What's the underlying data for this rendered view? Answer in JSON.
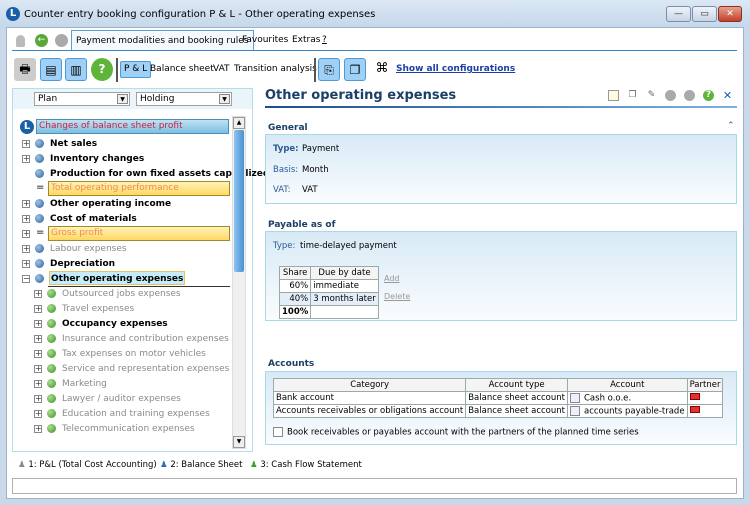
{
  "window": {
    "title": "Counter entry booking configuration  P & L - Other operating expenses",
    "minimize": "—",
    "maximize": "▭",
    "close": "✕"
  },
  "menu": {
    "tabs": [
      {
        "label": "Payment modalities and booking rules"
      },
      {
        "label": "Favourites"
      },
      {
        "label": "Extras"
      },
      {
        "label": "?"
      }
    ]
  },
  "toolbar": {
    "pl": "P & L",
    "balance_sheet": "Balance sheet",
    "vat": "VAT",
    "transition": "Transition analysis",
    "show_all": "Show all configurations"
  },
  "left": {
    "plan": "Plan",
    "holding": "Holding",
    "root": "Changes of balance sheet profit",
    "items": [
      {
        "label": "Net sales"
      },
      {
        "label": "Inventory changes"
      },
      {
        "label": "Production for own fixed assets capitalized"
      },
      {
        "label": "Total operating performance"
      },
      {
        "label": "Other operating income"
      },
      {
        "label": "Cost of materials"
      },
      {
        "label": "Gross profit"
      },
      {
        "label": "Labour expenses"
      },
      {
        "label": "Depreciation"
      },
      {
        "label": "Other operating expenses"
      },
      {
        "label": "Outsourced jobs expenses"
      },
      {
        "label": "Travel expenses"
      },
      {
        "label": "Occupancy expenses"
      },
      {
        "label": "Insurance and contribution expenses"
      },
      {
        "label": "Tax expenses on motor vehicles"
      },
      {
        "label": "Service and representation expenses"
      },
      {
        "label": "Marketing"
      },
      {
        "label": "Lawyer / auditor expenses"
      },
      {
        "label": "Education and training expenses"
      },
      {
        "label": "Telecommunication expenses"
      }
    ]
  },
  "detail": {
    "title": "Other operating expenses",
    "general": {
      "header": "General",
      "type_label": "Type:",
      "type": "Payment",
      "basis_label": "Basis:",
      "basis": "Month",
      "vat_label": "VAT:",
      "vat": "VAT"
    },
    "payable": {
      "header": "Payable as of",
      "type_label": "Type:",
      "type": "time-delayed payment",
      "columns": [
        "Share",
        "Due by date"
      ],
      "rows": [
        [
          "60%",
          "immediate"
        ],
        [
          "40%",
          "3 months later"
        ]
      ],
      "total": "100%",
      "add": "Add",
      "delete": "Delete"
    },
    "accounts": {
      "header": "Accounts",
      "columns": [
        "Category",
        "Account type",
        "Account",
        "Partner"
      ],
      "rows": [
        [
          "Bank account",
          "Balance sheet account",
          "Cash o.o.e."
        ],
        [
          "Accounts receivables or obligations account",
          "Balance sheet account",
          "accounts payable-trade"
        ]
      ],
      "checkbox": "Book receivables or payables account with the partners of the planned time series",
      "checkbox_checked": false
    }
  },
  "footer": {
    "items": [
      {
        "label": "1: P&L (Total Cost Accounting)"
      },
      {
        "label": "2: Balance Sheet"
      },
      {
        "label": "3: Cash Flow Statement"
      }
    ]
  }
}
